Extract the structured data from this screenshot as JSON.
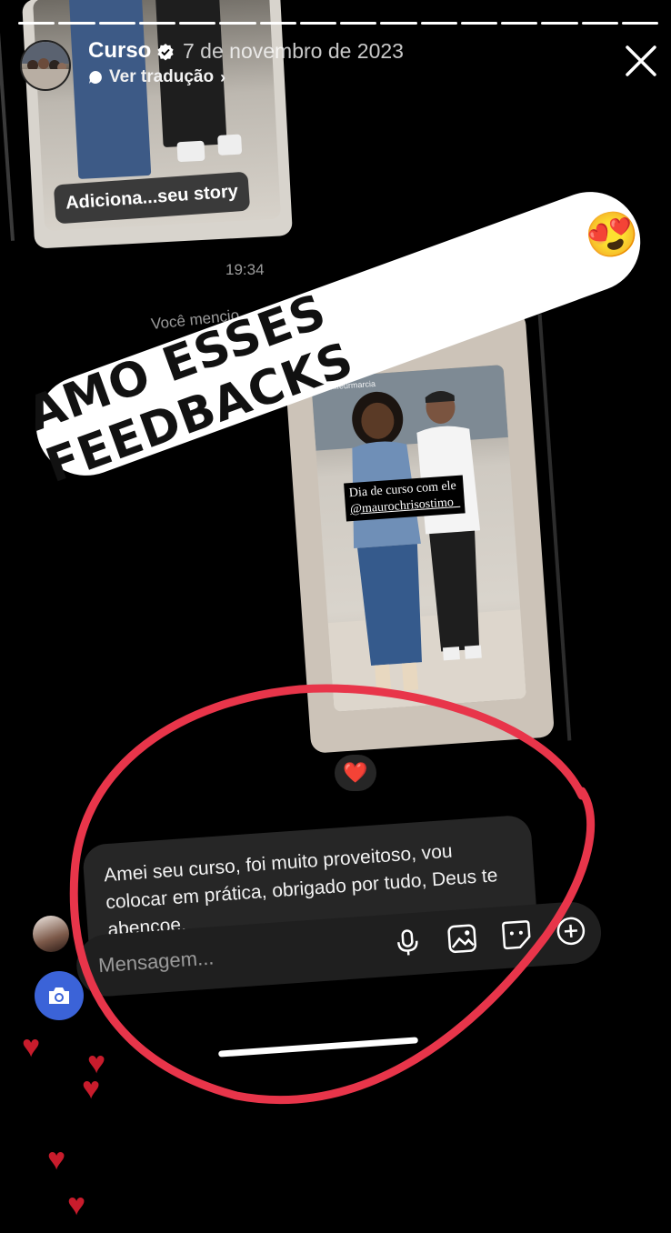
{
  "story": {
    "progress_segments": 16,
    "progress_done": 16
  },
  "header": {
    "account_name": "Curso",
    "date": "7 de novembro de 2023",
    "translate_label": "Ver tradução"
  },
  "old_story": {
    "tag_label": "Adiciona...seu story"
  },
  "thread": {
    "timestamp": "19:34",
    "mentioned_text": "Você mencio"
  },
  "sticker": {
    "text": "AMO ESSES FEEDBACKS",
    "emoji": "😍"
  },
  "shared_story": {
    "handle": "coiffeurmarcia",
    "caption_line1": "Dia de curso com ele",
    "caption_line2": "@maurochrisostimo_"
  },
  "reaction": {
    "emoji": "❤️"
  },
  "message": {
    "text": "Amei seu curso, foi muito proveitoso, vou colocar em prática, obrigado por tudo, Deus te abençoe."
  },
  "composer": {
    "placeholder": "Mensagem...",
    "icons": [
      "microphone-icon",
      "gallery-icon",
      "sticker-icon",
      "plus-icon"
    ]
  },
  "colors": {
    "annotation_red": "#e8354a",
    "heart_red": "#c81c2c",
    "camera_blue": "#3b63d8"
  }
}
